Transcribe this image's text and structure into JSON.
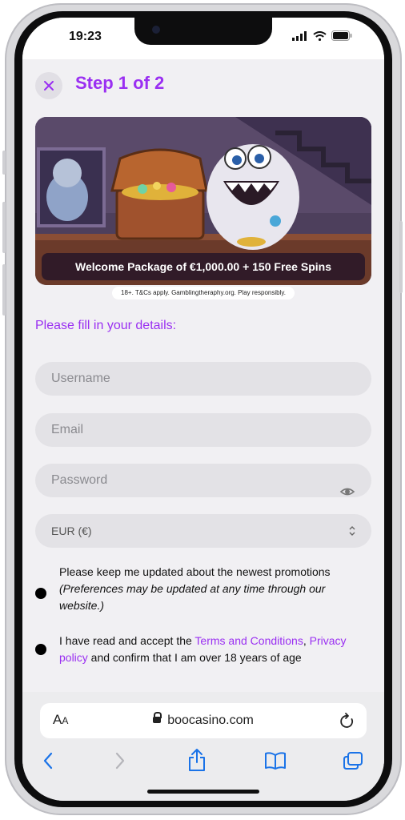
{
  "status": {
    "time": "19:23"
  },
  "header": {
    "step_title": "Step 1 of 2"
  },
  "banner": {
    "caption": "Welcome Package of €1,000.00 + 150 Free Spins",
    "disclaimer": "18+. T&Cs apply. Gamblingtheraphy.org. Play responsibly."
  },
  "form": {
    "prompt": "Please fill in your details:",
    "username_placeholder": "Username",
    "email_placeholder": "Email",
    "password_placeholder": "Password",
    "currency_value": "EUR (€)",
    "promo_text": "Please keep me updated about the newest promotions",
    "promo_note": "(Preferences may be updated at any time through our website.)",
    "terms_prefix": "I have read and accept the ",
    "terms_link": "Terms and Conditions",
    "terms_comma": ", ",
    "privacy_link": "Privacy policy",
    "terms_suffix": " and confirm that I am over 18 years of age"
  },
  "browser": {
    "text_size_label": "A",
    "text_size_small": "A",
    "url": "boocasino.com"
  },
  "colors": {
    "accent": "#9a2ff2",
    "banner_bg": "#4d3f5c"
  }
}
